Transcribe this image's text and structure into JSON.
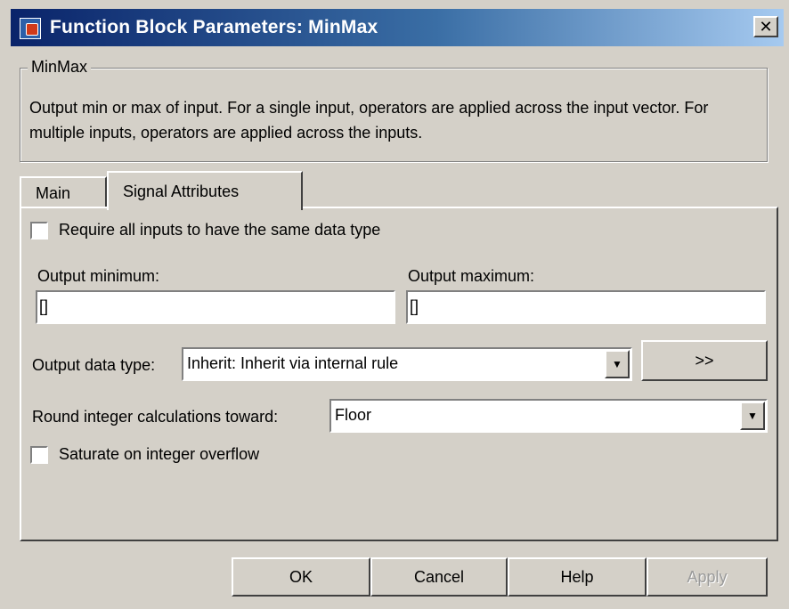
{
  "window": {
    "title": "Function Block Parameters: MinMax",
    "close_label": "✕"
  },
  "group": {
    "legend": "MinMax",
    "description": "Output min or max of input.  For a single input, operators are applied across the input vector.  For multiple inputs, operators are applied across the inputs."
  },
  "tabs": [
    {
      "label": "Main",
      "active": false
    },
    {
      "label": "Signal Attributes",
      "active": true
    }
  ],
  "panel": {
    "same_type_checkbox_label": "Require all inputs to have the same data type",
    "output_min_label": "Output minimum:",
    "output_min_value": "[]",
    "output_max_label": "Output maximum:",
    "output_max_value": "[]",
    "output_type_label": "Output data type:",
    "output_type_value": "Inherit: Inherit via internal rule",
    "assistant_button": ">>",
    "round_label": "Round integer calculations toward:",
    "round_value": "Floor",
    "saturate_label": "Saturate on integer overflow"
  },
  "buttons": {
    "ok": "OK",
    "cancel": "Cancel",
    "help": "Help",
    "apply": "Apply"
  }
}
